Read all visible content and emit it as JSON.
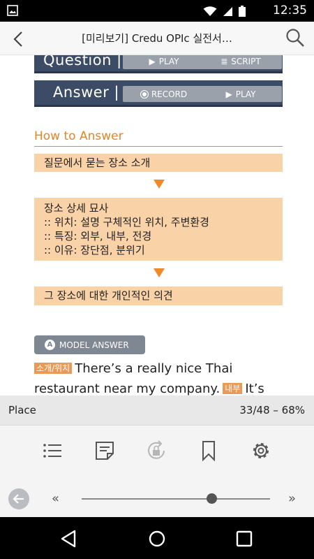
{
  "status_bar": {
    "time": "12:35",
    "icons": [
      "image-icon",
      "wifi-icon",
      "cell-signal-icon",
      "battery-icon"
    ]
  },
  "app_bar": {
    "title": "[미리보기] Credu OPIc 실전서…"
  },
  "content": {
    "question_bar": {
      "label": "Question |",
      "play": "PLAY",
      "script": "SCRIPT"
    },
    "answer_bar": {
      "label": "Answer |",
      "record": "RECORD",
      "play": "PLAY"
    },
    "how_to_answer": "How to Answer",
    "steps": {
      "step1": "질문에서 묻는 장소 소개",
      "step2_title": "장소 상세 묘사",
      "step2_line1": ":: 위치: 설명 구체적인 위치, 주변환경",
      "step2_line2": ":: 특징: 외부, 내부, 전경",
      "step2_line3": ":: 이유: 장단점, 분위기",
      "step3": "그 장소에 대한 개인적인 의견"
    },
    "model_answer_badge": "A",
    "model_answer": "MODEL ANSWER",
    "answer_text": {
      "tag1": "소개/위치",
      "sentence1": "There’s a really nice Thai restaurant near my company.",
      "tag2": "내부",
      "sentence2": "It’s not"
    }
  },
  "reader_status": {
    "chapter": "Place",
    "progress": "33/48 – 68%",
    "progress_fraction": 0.68
  },
  "toolbar": {
    "items": [
      "list-icon",
      "note-icon",
      "rotation-lock-icon",
      "bookmark-icon",
      "settings-icon"
    ]
  },
  "navigation": {
    "prev_label": "«",
    "next_label": "»"
  },
  "colors": {
    "accent": "#e38525",
    "box_fill": "#fad2a8",
    "bar_navy": "#3d4c66",
    "tag": "#eb9a55"
  }
}
